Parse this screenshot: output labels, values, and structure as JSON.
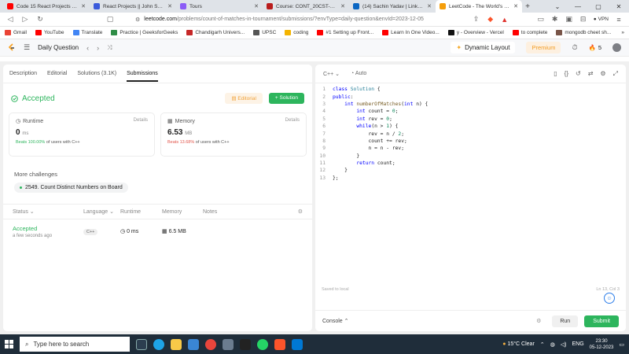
{
  "browser": {
    "tabs": [
      {
        "title": "Code 15 React Projects - Complete",
        "color": "#ff0000",
        "active": false
      },
      {
        "title": "React Projects || John Smilga",
        "color": "#3b5bdb",
        "active": false
      },
      {
        "title": "Tours",
        "color": "#8b5cf6",
        "active": false
      },
      {
        "title": "Course: CONT_20CST-412 :: BLOCK",
        "color": "#b91c1c",
        "active": false
      },
      {
        "title": "(14) Sachin Yadav | LinkedIn",
        "color": "#0a66c2",
        "active": false
      },
      {
        "title": "LeetCode - The World's Leading",
        "color": "#f59e0b",
        "active": true
      }
    ],
    "url_host": "leetcode.com",
    "url_path": "/problems/count-of-matches-in-tournament/submissions/?envType=daily-question&envId=2023-12-05",
    "vpn_label": "VPN",
    "bookmarks": [
      {
        "label": "Gmail",
        "color": "#ea4335"
      },
      {
        "label": "YouTube",
        "color": "#ff0000"
      },
      {
        "label": "Translate",
        "color": "#4285f4"
      },
      {
        "label": "Practice | GeeksforGeeks",
        "color": "#2f8d46"
      },
      {
        "label": "Chandigarh Univers...",
        "color": "#c62828"
      },
      {
        "label": "UPSC",
        "color": "#555555"
      },
      {
        "label": "coding",
        "color": "#f4b400"
      },
      {
        "label": "#1 Setting up Front...",
        "color": "#ff0000"
      },
      {
        "label": "Learn In One Video...",
        "color": "#ff0000"
      },
      {
        "label": "y - Overview - Vercel",
        "color": "#111111"
      },
      {
        "label": "to complete",
        "color": "#ff0000"
      },
      {
        "label": "mongodb cheet sh...",
        "color": "#795548"
      }
    ]
  },
  "header": {
    "title": "Daily Question",
    "dynamic_layout": "Dynamic Layout",
    "premium": "Premium",
    "streak": "5"
  },
  "left_panel": {
    "tabs": [
      "Description",
      "Editorial",
      "Solutions (3.1K)",
      "Submissions"
    ],
    "active_tab": "Submissions",
    "status": "Accepted",
    "editorial_btn": "Editorial",
    "solution_btn": "Solution",
    "runtime": {
      "label": "Runtime",
      "details": "Details",
      "value": "0",
      "unit": "ms",
      "beats_pct": "Beats 100.00%",
      "beats_suffix": "of users with C++"
    },
    "memory": {
      "label": "Memory",
      "details": "Details",
      "value": "6.53",
      "unit": "MB",
      "beats_pct": "Beats 13.68%",
      "beats_suffix": "of users with C++"
    },
    "more_challenges": "More challenges",
    "challenge": "2549. Count Distinct Numbers on Board",
    "table_headers": {
      "status": "Status",
      "language": "Language",
      "runtime": "Runtime",
      "memory": "Memory",
      "notes": "Notes"
    },
    "row": {
      "status": "Accepted",
      "time": "a few seconds ago",
      "language": "C++",
      "runtime": "0 ms",
      "memory": "6.5 MB"
    }
  },
  "editor": {
    "language": "C++",
    "mode": "Auto",
    "code": [
      [
        [
          "kw",
          "class "
        ],
        [
          "ty",
          "Solution"
        ],
        [
          "tx",
          " {"
        ]
      ],
      [
        [
          "kw",
          "public"
        ],
        [
          "tx",
          ":"
        ]
      ],
      [
        [
          "tx",
          "    "
        ],
        [
          "kw",
          "int "
        ],
        [
          "fn",
          "numberOfMatches"
        ],
        [
          "tx",
          "("
        ],
        [
          "kw",
          "int "
        ],
        [
          "tx",
          "n) {"
        ]
      ],
      [
        [
          "tx",
          "        "
        ],
        [
          "kw",
          "int "
        ],
        [
          "tx",
          "count = "
        ],
        [
          "num",
          "0"
        ],
        [
          "tx",
          ";"
        ]
      ],
      [
        [
          "tx",
          "        "
        ],
        [
          "kw",
          "int "
        ],
        [
          "tx",
          "rev = "
        ],
        [
          "num",
          "0"
        ],
        [
          "tx",
          ";"
        ]
      ],
      [
        [
          "tx",
          "        "
        ],
        [
          "kw",
          "while"
        ],
        [
          "tx",
          "(n > "
        ],
        [
          "num",
          "1"
        ],
        [
          "tx",
          ") {"
        ]
      ],
      [
        [
          "tx",
          "            rev = n / "
        ],
        [
          "num",
          "2"
        ],
        [
          "tx",
          ";"
        ]
      ],
      [
        [
          "tx",
          "            count += rev;"
        ]
      ],
      [
        [
          "tx",
          "            n = n - rev;"
        ]
      ],
      [
        [
          "tx",
          "        }"
        ]
      ],
      [
        [
          "tx",
          "        "
        ],
        [
          "kw",
          "return "
        ],
        [
          "tx",
          "count;"
        ]
      ],
      [
        [
          "tx",
          "    }"
        ]
      ],
      [
        [
          "tx",
          "};"
        ]
      ]
    ],
    "saved": "Saved to local",
    "cursor": "Ln 13, Col 3",
    "console": "Console",
    "run": "Run",
    "submit": "Submit"
  },
  "taskbar": {
    "search_placeholder": "Type here to search",
    "weather": "15°C  Clear",
    "lang": "ENG",
    "time": "23:30",
    "date": "05-12-2023"
  }
}
